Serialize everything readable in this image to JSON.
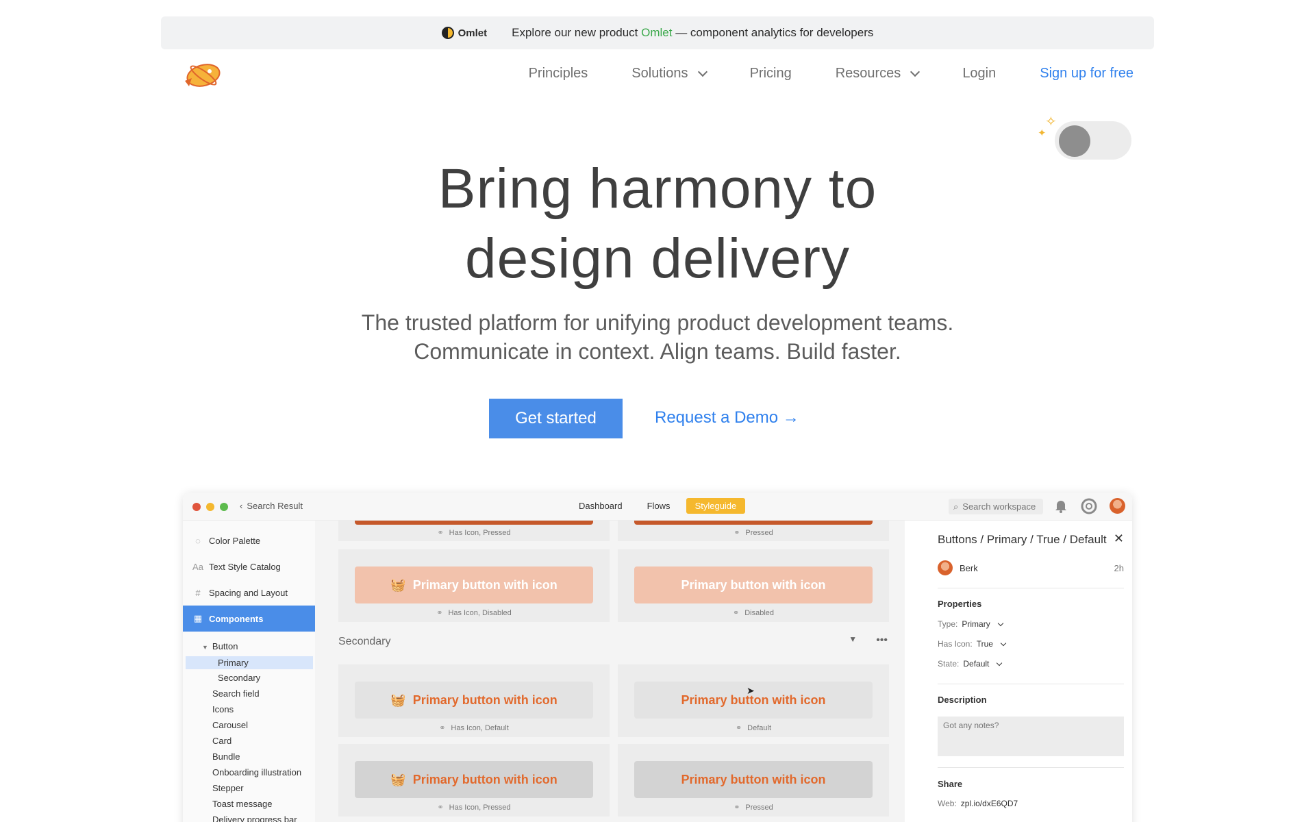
{
  "announcement": {
    "omlet_label": "Omlet",
    "text_before": "Explore our new product ",
    "highlight": "Omlet",
    "text_after": " — component analytics for developers"
  },
  "nav": {
    "items": [
      {
        "label": "Principles",
        "dropdown": false
      },
      {
        "label": "Solutions",
        "dropdown": true
      },
      {
        "label": "Pricing",
        "dropdown": false
      },
      {
        "label": "Resources",
        "dropdown": true
      },
      {
        "label": "Login",
        "dropdown": false
      }
    ],
    "cta": "Sign up for free"
  },
  "hero": {
    "title_line1": "Bring harmony to",
    "title_line2": "design delivery",
    "sub_line1": "The trusted platform for unifying product development teams.",
    "sub_line2": "Communicate in context. Align teams. Build faster.",
    "primary_cta": "Get started",
    "secondary_cta": "Request a Demo →"
  },
  "colors": {
    "accent_blue": "#4a8de8",
    "link_blue": "#2f80ed",
    "styleguide_tab": "#f5b82e",
    "button_orange": "#e2692c",
    "omlet_green": "#3aa84a"
  },
  "app": {
    "back_label": "Search Result",
    "tabs": [
      "Dashboard",
      "Flows",
      "Styleguide"
    ],
    "active_tab": "Styleguide",
    "search_placeholder": "Search workspace",
    "sidebar": {
      "main": [
        {
          "label": "Color Palette",
          "icon": "palette-icon"
        },
        {
          "label": "Text Style Catalog",
          "icon": "text-style-icon"
        },
        {
          "label": "Spacing and Layout",
          "icon": "spacing-icon"
        },
        {
          "label": "Components",
          "icon": "components-icon"
        }
      ],
      "tree_parent": "Button",
      "tree_children": [
        "Primary",
        "Secondary"
      ],
      "components": [
        "Search field",
        "Icons",
        "Carousel",
        "Card",
        "Bundle",
        "Onboarding illustration",
        "Stepper",
        "Toast message",
        "Delivery progress bar"
      ]
    },
    "canvas": {
      "button_label": "Primary button with icon",
      "section_title": "Secondary",
      "captions": {
        "top_left": "Has Icon, Pressed",
        "top_right": "Pressed",
        "dis_left": "Has Icon, Disabled",
        "dis_right": "Disabled",
        "def_left": "Has Icon, Default",
        "def_right": "Default",
        "pr_left": "Has Icon, Pressed",
        "pr_right": "Pressed"
      }
    },
    "panel": {
      "title": "Buttons / Primary / True / Default",
      "user": "Berk",
      "time": "2h",
      "properties_heading": "Properties",
      "props": [
        {
          "key": "Type:",
          "value": "Primary"
        },
        {
          "key": "Has Icon:",
          "value": "True"
        },
        {
          "key": "State:",
          "value": "Default"
        }
      ],
      "description_heading": "Description",
      "notes_placeholder": "Got any notes?",
      "share_heading": "Share",
      "web_label": "Web:",
      "web_value": "zpl.io/dxE6QD7"
    }
  }
}
